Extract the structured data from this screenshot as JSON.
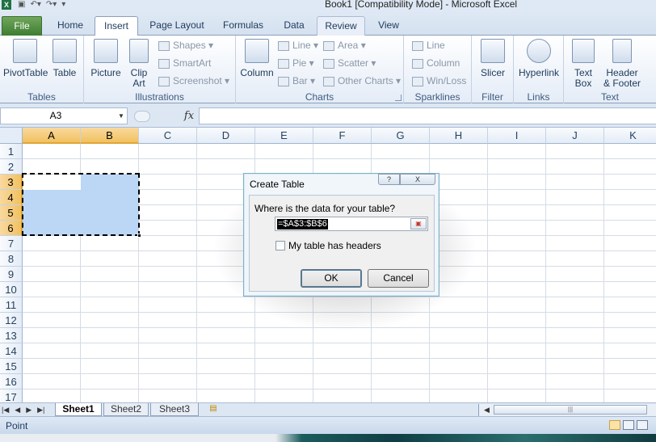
{
  "window": {
    "title": "Book1  [Compatibility Mode]  -  Microsoft Excel",
    "app_icon": "X"
  },
  "ribbon_tabs": [
    "File",
    "Home",
    "Insert",
    "Page Layout",
    "Formulas",
    "Data",
    "Review",
    "View"
  ],
  "ribbon": {
    "tables": {
      "label": "Tables",
      "pivottable": "PivotTable",
      "table": "Table"
    },
    "illustrations": {
      "label": "Illustrations",
      "picture": "Picture",
      "clip_art_1": "Clip",
      "clip_art_2": "Art",
      "shapes": "Shapes",
      "smartart": "SmartArt",
      "screenshot": "Screenshot"
    },
    "charts": {
      "label": "Charts",
      "column": "Column",
      "line": "Line",
      "pie": "Pie",
      "bar": "Bar",
      "area": "Area",
      "scatter": "Scatter",
      "other": "Other Charts"
    },
    "sparklines": {
      "label": "Sparklines",
      "line": "Line",
      "column": "Column",
      "winloss": "Win/Loss"
    },
    "filter": {
      "label": "Filter",
      "slicer": "Slicer"
    },
    "links": {
      "label": "Links",
      "hyperlink": "Hyperlink"
    },
    "text": {
      "label": "Text",
      "textbox_1": "Text",
      "textbox_2": "Box",
      "header_1": "Header",
      "header_2": "& Footer"
    }
  },
  "formula_bar": {
    "name_box": "A3",
    "fx": "fx",
    "formula": ""
  },
  "grid": {
    "columns": [
      "A",
      "B",
      "C",
      "D",
      "E",
      "F",
      "G",
      "H",
      "I",
      "J",
      "K"
    ],
    "rows": [
      "1",
      "2",
      "3",
      "4",
      "5",
      "6",
      "7",
      "8",
      "9",
      "10",
      "11",
      "12",
      "13",
      "14",
      "15",
      "16",
      "17"
    ],
    "selected_range": "A3:B6",
    "active_cell": "A3"
  },
  "dialog": {
    "title": "Create Table",
    "help_label": "?",
    "close_label": "X",
    "prompt": "Where is the data for your table?",
    "range_value": "=$A$3:$B$6",
    "checkbox_label": "My table has headers",
    "checkbox_checked": false,
    "ok_label": "OK",
    "cancel_label": "Cancel"
  },
  "sheets": [
    "Sheet1",
    "Sheet2",
    "Sheet3"
  ],
  "active_sheet": "Sheet1",
  "status": {
    "mode": "Point"
  },
  "colors": {
    "selection": "#bcd7f5",
    "active_header": "#f1c15f",
    "file_tab": "#3e7d31"
  }
}
